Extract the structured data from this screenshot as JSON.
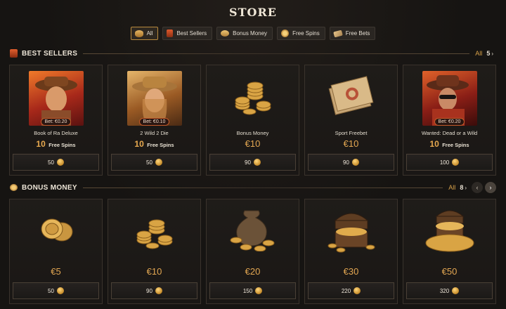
{
  "page": {
    "title": "STORE"
  },
  "filters": [
    {
      "label": "All",
      "icon": "treasure-icon",
      "active": true
    },
    {
      "label": "Best Sellers",
      "icon": "fire-book-icon",
      "active": false
    },
    {
      "label": "Bonus Money",
      "icon": "coin-stack-icon",
      "active": false
    },
    {
      "label": "Free Spins",
      "icon": "spin-wheel-icon",
      "active": false
    },
    {
      "label": "Free Bets",
      "icon": "ticket-icon",
      "active": false
    }
  ],
  "best_sellers": {
    "label": "BEST SELLERS",
    "all_label": "All",
    "count": "5",
    "items": [
      {
        "name": "Book of Ra Deluxe",
        "bet": "Bet: €0.20",
        "reward_num": "10",
        "reward_unit": "Free Spins",
        "price": "50"
      },
      {
        "name": "2 Wild 2 Die",
        "bet": "Bet: €0.10",
        "reward_num": "10",
        "reward_unit": "Free Spins",
        "price": "50"
      },
      {
        "name": "Bonus Money",
        "reward_euro": "€10",
        "price": "90"
      },
      {
        "name": "Sport Freebet",
        "reward_euro": "€10",
        "price": "90"
      },
      {
        "name": "Wanted: Dead or a Wild",
        "bet": "Bet: €0.20",
        "reward_num": "10",
        "reward_unit": "Free Spins",
        "price": "100"
      }
    ]
  },
  "bonus_money": {
    "label": "BONUS MONEY",
    "all_label": "All",
    "count": "8",
    "items": [
      {
        "reward_euro": "€5",
        "price": "50"
      },
      {
        "reward_euro": "€10",
        "price": "90"
      },
      {
        "reward_euro": "€20",
        "price": "150"
      },
      {
        "reward_euro": "€30",
        "price": "220"
      },
      {
        "reward_euro": "€50",
        "price": "320"
      }
    ]
  }
}
